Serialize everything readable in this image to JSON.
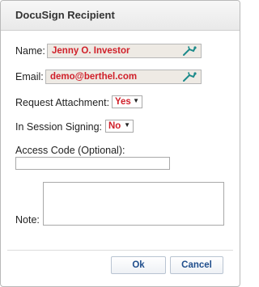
{
  "dialog": {
    "title": "DocuSign Recipient",
    "name_label": "Name:",
    "name_value": "Jenny O. Investor",
    "email_label": "Email:",
    "email_value": "demo@berthel.com",
    "request_attachment_label": "Request Attachment:",
    "request_attachment_value": "Yes",
    "in_session_label": "In Session Signing:",
    "in_session_value": "No",
    "access_code_label": "Access Code (Optional):",
    "access_code_value": "",
    "note_label": "Note:",
    "note_value": "",
    "ok_label": "Ok",
    "cancel_label": "Cancel"
  },
  "icons": {
    "picker": "person-picker-icon",
    "dropdown": "caret-down-icon"
  },
  "colors": {
    "value_text": "#d0202a",
    "button_text": "#1f4e8c",
    "picker_icon": "#1b8a8a"
  }
}
